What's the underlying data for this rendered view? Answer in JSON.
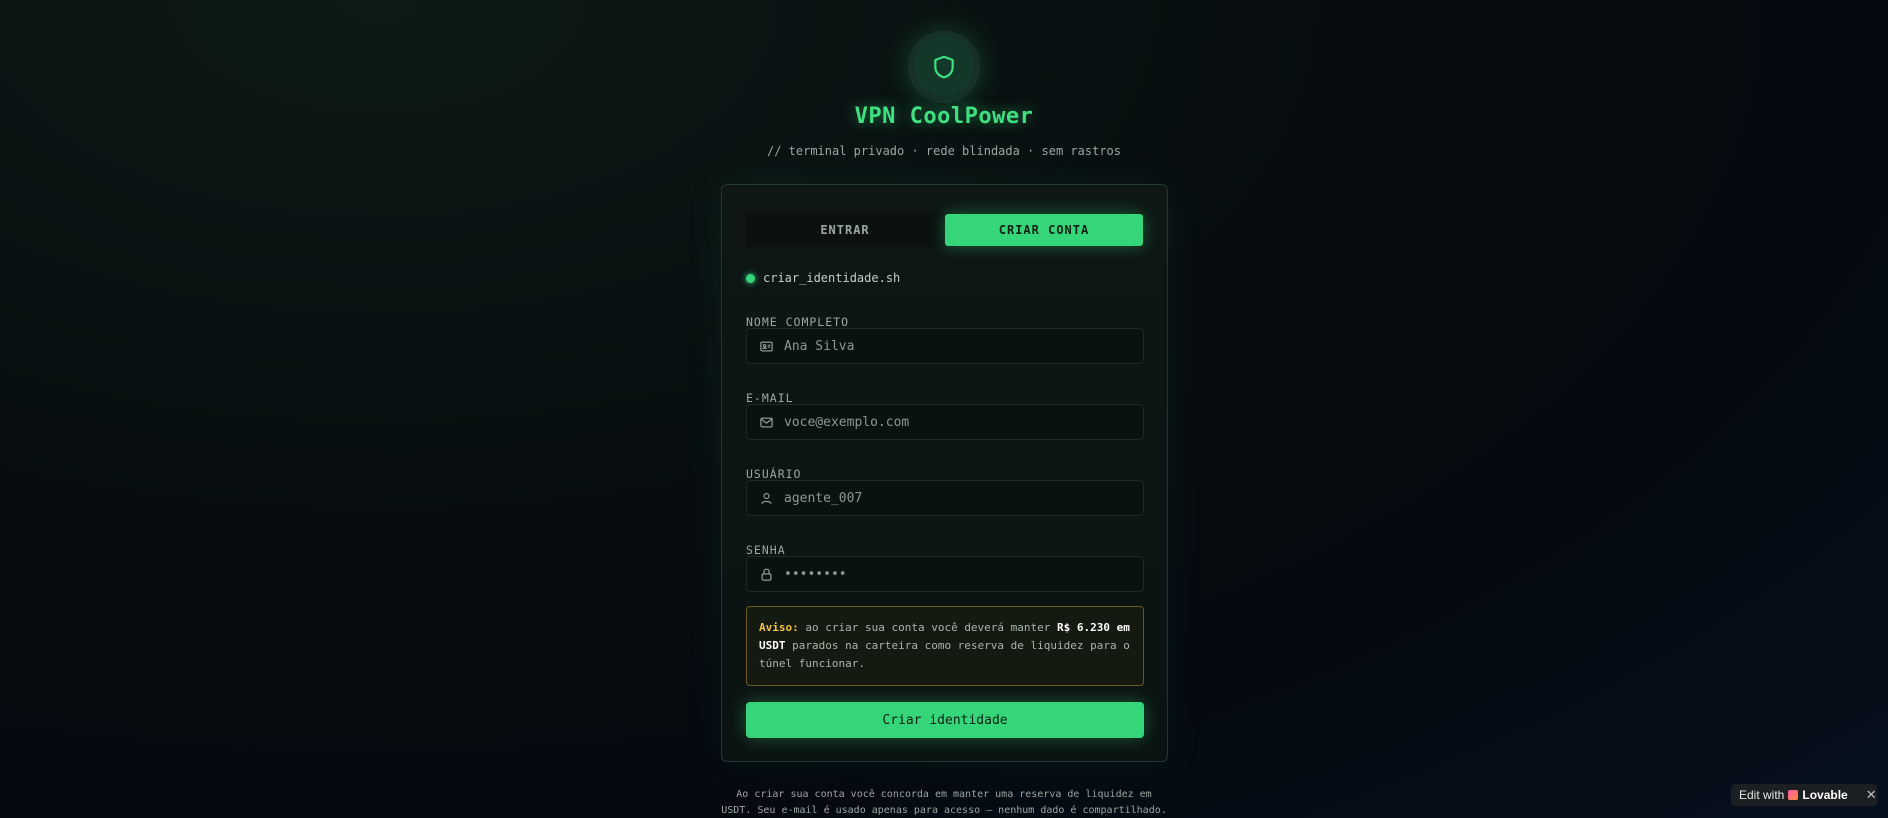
{
  "brand": {
    "title": "VPN CoolPower",
    "tagline": "// terminal privado · rede blindada · sem rastros",
    "logo_icon": "shield-icon",
    "accent_color": "#35d67a"
  },
  "tabs": [
    {
      "label": "ENTRAR",
      "active": false
    },
    {
      "label": "CRIAR CONTA",
      "active": true
    }
  ],
  "form": {
    "script_name": "criar_identidade.sh",
    "fields": [
      {
        "label": "NOME COMPLETO",
        "placeholder": "Ana Silva",
        "icon": "id-card-icon"
      },
      {
        "label": "E-MAIL",
        "placeholder": "voce@exemplo.com",
        "icon": "mail-icon"
      },
      {
        "label": "USUÁRIO",
        "placeholder": "agente_007",
        "icon": "user-icon"
      },
      {
        "label": "SENHA",
        "placeholder": "••••••••",
        "icon": "lock-icon"
      }
    ],
    "notice": {
      "prefix": "Aviso:",
      "text_before": " ao criar sua conta você deverá manter ",
      "amount": "R$ 6.230 em USDT",
      "text_after": " parados na carteira como reserva de liquidez para o túnel funcionar.",
      "warn_color": "#f2c23a"
    },
    "submit_label": "Criar identidade"
  },
  "footer": {
    "text": "Ao criar sua conta você concorda em manter uma reserva de liquidez em USDT. Seu e-mail é usado apenas para acesso — nenhum dado é compartilhado."
  },
  "badge": {
    "prefix": "Edit with",
    "name": "Lovable",
    "close": "✕"
  }
}
